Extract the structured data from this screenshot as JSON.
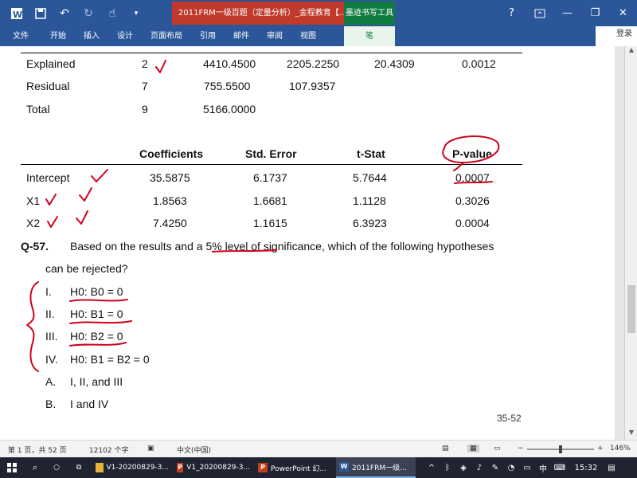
{
  "window": {
    "title": "2011FRM一级百题（定量分析）_金程教育【...",
    "context_tool": "墨迹书写工具",
    "help": "?",
    "login": "登录"
  },
  "ribbon": {
    "tabs": [
      "文件",
      "开始",
      "插入",
      "设计",
      "页面布局",
      "引用",
      "邮件",
      "审阅",
      "视图"
    ],
    "pen_tab": "笔"
  },
  "anova": {
    "rows": [
      {
        "label": "Explained",
        "df": "2",
        "ss": "4410.4500",
        "ms": "2205.2250",
        "f": "20.4309",
        "sig": "0.0012"
      },
      {
        "label": "Residual",
        "df": "7",
        "ss": "755.5500",
        "ms": "107.9357"
      },
      {
        "label": "Total",
        "df": "9",
        "ss": "5166.0000"
      }
    ]
  },
  "coef_table": {
    "headers": [
      "Coefficients",
      "Std. Error",
      "t-Stat",
      "P-value"
    ],
    "rows": [
      {
        "label": "Intercept",
        "coef": "35.5875",
        "se": "6.1737",
        "t": "5.7644",
        "p": "0.0007"
      },
      {
        "label": "X1",
        "coef": "1.8563",
        "se": "1.6681",
        "t": "1.1128",
        "p": "0.3026"
      },
      {
        "label": "X2",
        "coef": "7.4250",
        "se": "1.1615",
        "t": "6.3923",
        "p": "0.0004"
      }
    ]
  },
  "question": {
    "number": "Q-57.",
    "text_line1": "Based on the results and a 5% level of significance, which of the following hypotheses",
    "text_line2": "can be rejected?",
    "hypotheses": [
      {
        "num": "I.",
        "text": "H0: B0 = 0"
      },
      {
        "num": "II.",
        "text": "H0: B1 = 0"
      },
      {
        "num": "III.",
        "text": "H0: B2 = 0"
      },
      {
        "num": "IV.",
        "text": "H0: B1 = B2 = 0"
      }
    ],
    "options": [
      {
        "letter": "A.",
        "text": "I, II, and III"
      },
      {
        "letter": "B.",
        "text": "I and IV"
      }
    ],
    "page_marker": "35-52"
  },
  "statusbar": {
    "page": "第 1 页，共 52 页",
    "words": "12102 个字",
    "lang": "中文(中国)",
    "zoom": "146%"
  },
  "taskbar": {
    "items": [
      "V1-20200829-3...",
      "V1_20200829-3...",
      "PowerPoint 幻...",
      "2011FRM一级..."
    ],
    "ime": "中",
    "time": "15:32"
  },
  "colors": {
    "ink": "#d0021b",
    "word_blue": "#2b579a",
    "ink_tool_green": "#107c41"
  }
}
